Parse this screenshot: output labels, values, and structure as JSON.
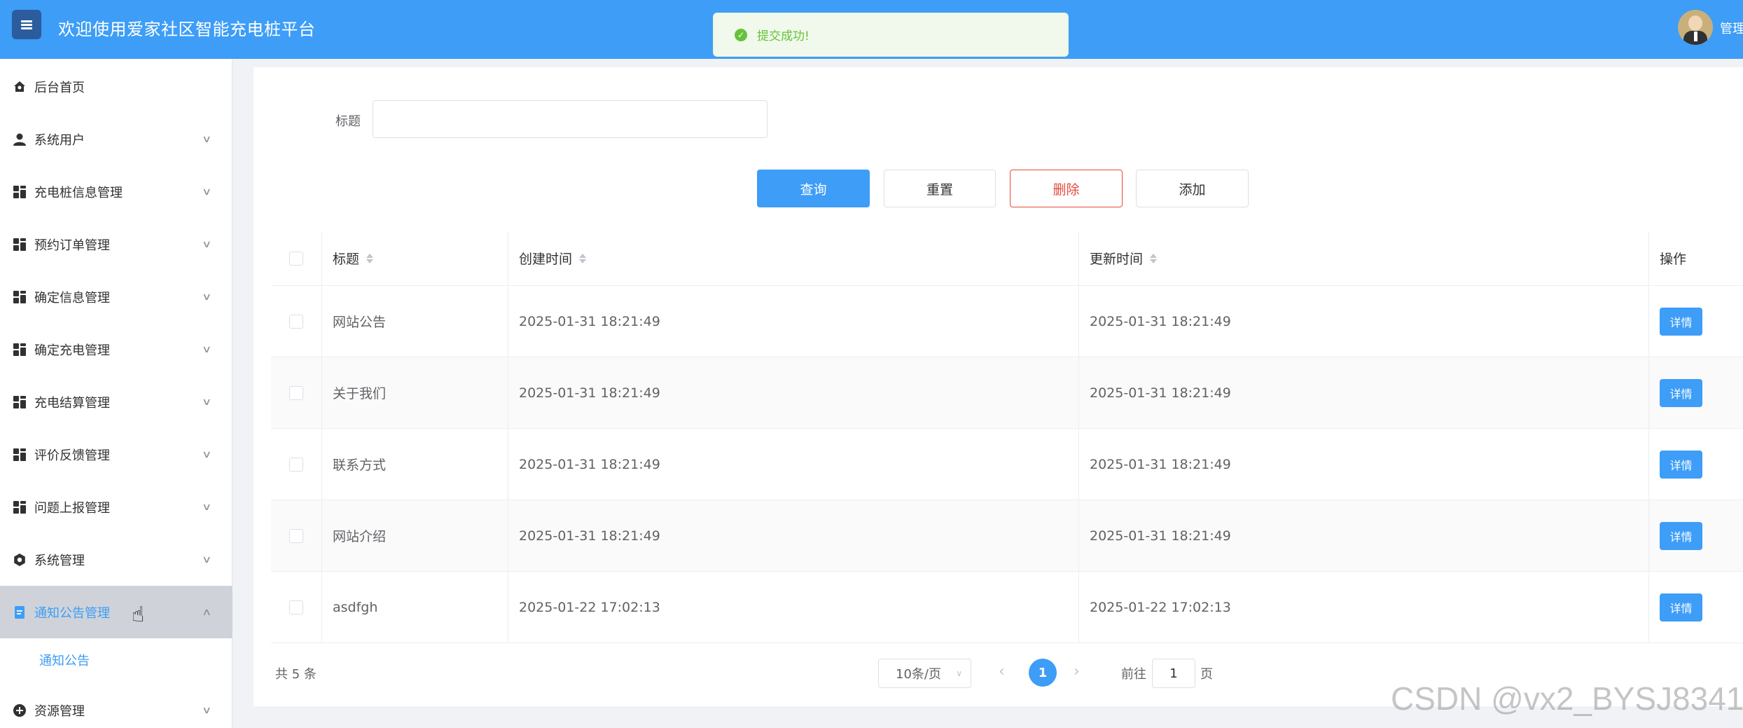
{
  "header": {
    "title": "欢迎使用爱家社区智能充电桩平台",
    "user": "管理"
  },
  "toast": {
    "message": "提交成功!",
    "color": "#67c23a"
  },
  "sidebar": {
    "items": [
      {
        "label": "后台首页",
        "icon": "home-icon"
      },
      {
        "label": "系统用户",
        "icon": "user-icon"
      },
      {
        "label": "充电桩信息管理",
        "icon": "grid-icon"
      },
      {
        "label": "预约订单管理",
        "icon": "grid-icon"
      },
      {
        "label": "确定信息管理",
        "icon": "grid-icon"
      },
      {
        "label": "确定充电管理",
        "icon": "grid-icon"
      },
      {
        "label": "充电结算管理",
        "icon": "grid-icon"
      },
      {
        "label": "评价反馈管理",
        "icon": "grid-icon"
      },
      {
        "label": "问题上报管理",
        "icon": "grid-icon"
      },
      {
        "label": "系统管理",
        "icon": "gear-icon"
      },
      {
        "label": "通知公告管理",
        "icon": "document-icon"
      },
      {
        "label": "资源管理",
        "icon": "plus-circle-icon"
      }
    ],
    "sub_item": "通知公告"
  },
  "search": {
    "label": "标题",
    "value": ""
  },
  "buttons": {
    "query": "查询",
    "reset": "重置",
    "delete": "删除",
    "add": "添加"
  },
  "table": {
    "headers": {
      "title": "标题",
      "created": "创建时间",
      "updated": "更新时间",
      "action": "操作"
    },
    "rows": [
      {
        "title": "网站公告",
        "created": "2025-01-31 18:21:49",
        "updated": "2025-01-31 18:21:49",
        "action": "详情"
      },
      {
        "title": "关于我们",
        "created": "2025-01-31 18:21:49",
        "updated": "2025-01-31 18:21:49",
        "action": "详情"
      },
      {
        "title": "联系方式",
        "created": "2025-01-31 18:21:49",
        "updated": "2025-01-31 18:21:49",
        "action": "详情"
      },
      {
        "title": "网站介绍",
        "created": "2025-01-31 18:21:49",
        "updated": "2025-01-31 18:21:49",
        "action": "详情"
      },
      {
        "title": "asdfgh",
        "created": "2025-01-22 17:02:13",
        "updated": "2025-01-22 17:02:13",
        "action": "详情"
      }
    ]
  },
  "pagination": {
    "total": "共 5 条",
    "page_size": "10条/页",
    "current_page": "1",
    "goto_label": "前往",
    "goto_value": "1",
    "goto_unit": "页"
  },
  "watermark": "CSDN @vx2_BYSJ8341",
  "colors": {
    "primary": "#3d9df7",
    "danger": "#e64a3c",
    "success": "#67c23a"
  }
}
